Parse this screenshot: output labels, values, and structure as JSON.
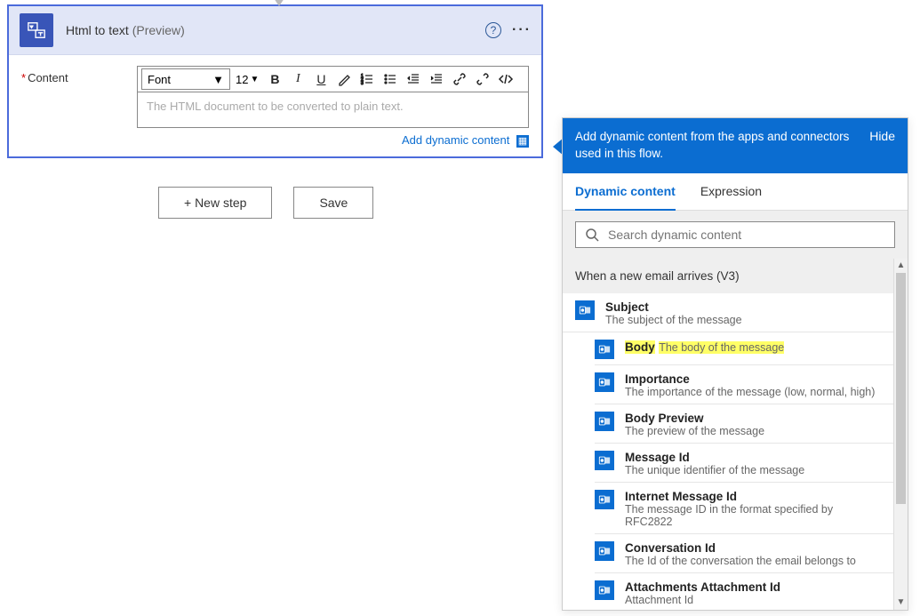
{
  "card": {
    "title": "Html to text",
    "preview": "(Preview)",
    "content_label": "Content",
    "font_label": "Font",
    "font_size": "12",
    "content_placeholder": "The HTML document to be converted to plain text.",
    "add_dynamic": "Add dynamic content"
  },
  "buttons": {
    "new_step": "+ New step",
    "save": "Save"
  },
  "dc": {
    "header": "Add dynamic content from the apps and connectors used in this flow.",
    "hide": "Hide",
    "tab_dynamic": "Dynamic content",
    "tab_expression": "Expression",
    "search_placeholder": "Search dynamic content",
    "section": "When a new email arrives (V3)",
    "items": [
      {
        "title": "Subject",
        "desc": "The subject of the message",
        "hl": false
      },
      {
        "title": "Body",
        "desc": "The body of the message",
        "hl": true
      },
      {
        "title": "Importance",
        "desc": "The importance of the message (low, normal, high)",
        "hl": false
      },
      {
        "title": "Body Preview",
        "desc": "The preview of the message",
        "hl": false
      },
      {
        "title": "Message Id",
        "desc": "The unique identifier of the message",
        "hl": false
      },
      {
        "title": "Internet Message Id",
        "desc": "The message ID in the format specified by RFC2822",
        "hl": false
      },
      {
        "title": "Conversation Id",
        "desc": "The Id of the conversation the email belongs to",
        "hl": false
      },
      {
        "title": "Attachments Attachment Id",
        "desc": "Attachment Id",
        "hl": false
      }
    ]
  }
}
